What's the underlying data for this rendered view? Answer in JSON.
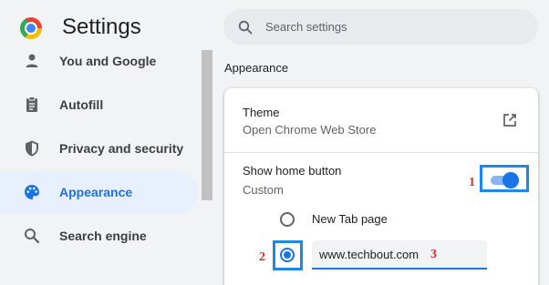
{
  "header": {
    "title": "Settings",
    "logo": "chrome-logo",
    "search": {
      "placeholder": "Search settings",
      "icon": "search-icon"
    }
  },
  "sidebar": {
    "items": [
      {
        "label": "You and Google",
        "icon": "person-icon"
      },
      {
        "label": "Autofill",
        "icon": "clipboard-icon"
      },
      {
        "label": "Privacy and security",
        "icon": "shield-icon"
      },
      {
        "label": "Appearance",
        "icon": "palette-icon",
        "active": true
      },
      {
        "label": "Search engine",
        "icon": "search-icon"
      }
    ]
  },
  "main": {
    "section_title": "Appearance",
    "theme": {
      "title": "Theme",
      "subtitle": "Open Chrome Web Store",
      "icon": "external-link-icon"
    },
    "home_button": {
      "title": "Show home button",
      "subtitle": "Custom",
      "enabled": true,
      "options": [
        {
          "label": "New Tab page",
          "selected": false
        },
        {
          "value": "www.techbout.com",
          "selected": true
        }
      ]
    }
  },
  "annotations": {
    "toggle": "1",
    "radio": "2",
    "url": "3"
  },
  "colors": {
    "accent": "#1a73e8",
    "annotation": "#d32f2f",
    "highlight_box": "#1e88e5",
    "active_nav_bg": "#e8f0fe"
  }
}
